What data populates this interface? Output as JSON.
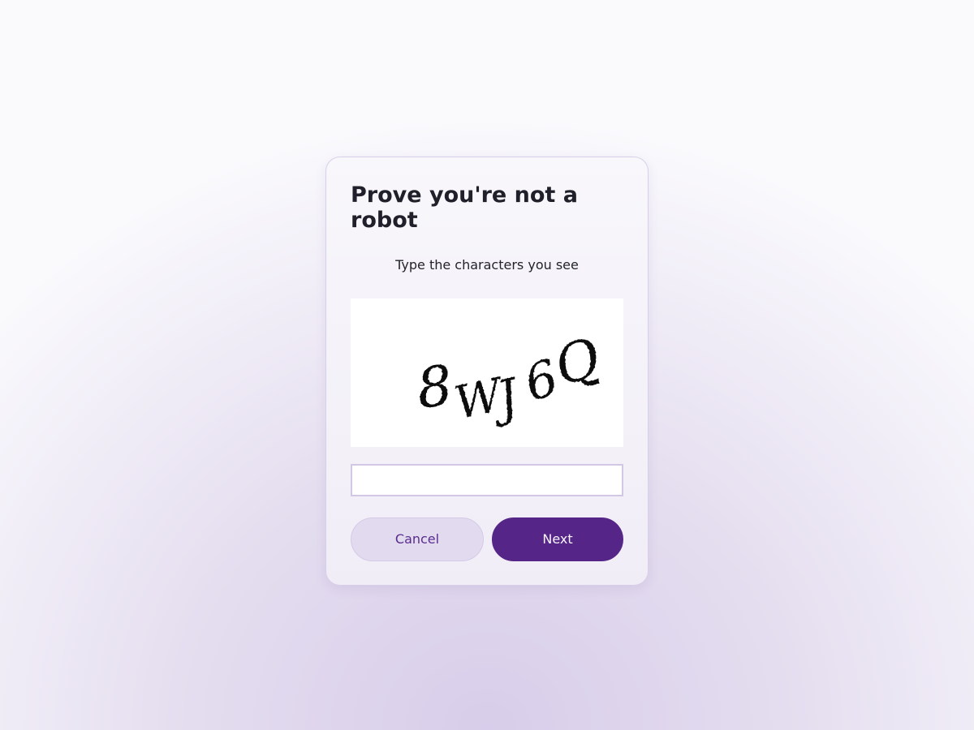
{
  "dialog": {
    "title": "Prove you're not a robot",
    "instruction": "Type the characters you see",
    "captcha_text": "8WJ6Q",
    "input_value": "",
    "cancel_label": "Cancel",
    "next_label": "Next"
  },
  "colors": {
    "accent": "#552687",
    "cancel_background": "#e2dbef",
    "cancel_text": "#5a2c8d",
    "title_text": "#20202a"
  }
}
